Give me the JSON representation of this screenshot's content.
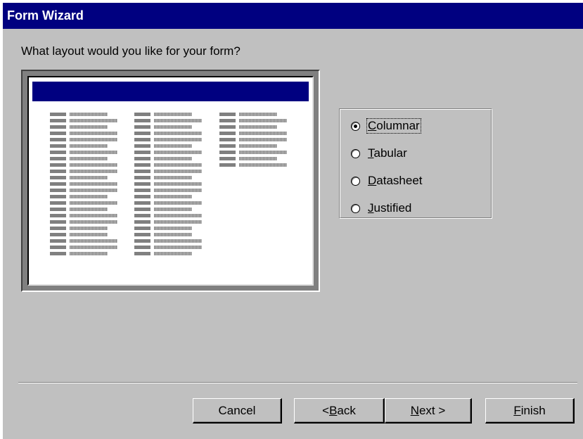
{
  "window": {
    "title": "Form Wizard"
  },
  "question": "What layout would you like for your form?",
  "layout_options": [
    {
      "label": "Columnar",
      "mnemonic": "C",
      "rest": "olumnar",
      "selected": true
    },
    {
      "label": "Tabular",
      "mnemonic": "T",
      "rest": "abular",
      "selected": false
    },
    {
      "label": "Datasheet",
      "mnemonic": "D",
      "rest": "atasheet",
      "selected": false
    },
    {
      "label": "Justified",
      "mnemonic": "J",
      "rest": "ustified",
      "selected": false
    }
  ],
  "buttons": {
    "cancel": {
      "label": "Cancel"
    },
    "back": {
      "prefix": "< ",
      "mnemonic": "B",
      "rest": "ack"
    },
    "next": {
      "mnemonic": "N",
      "rest": "ext >"
    },
    "finish": {
      "mnemonic": "F",
      "rest": "inish"
    }
  },
  "colors": {
    "title_bar": "#000080",
    "dialog_bg": "#c0c0c0",
    "preview_header": "#000080"
  }
}
